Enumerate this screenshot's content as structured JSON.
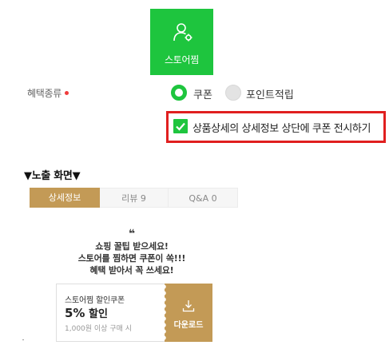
{
  "tile": {
    "label": "스토어찜",
    "icon": "user-gear-icon"
  },
  "benefit": {
    "label": "혜택종류",
    "options": [
      {
        "label": "쿠폰",
        "selected": true
      },
      {
        "label": "포인트적립",
        "selected": false
      }
    ]
  },
  "display_option": {
    "label": "상품상세의 상세정보 상단에 쿠폰 전시하기",
    "checked": true
  },
  "exposure": {
    "title": "▼노출 화면▼",
    "tabs": [
      {
        "label": "상세정보",
        "active": true
      },
      {
        "label": "리뷰  9",
        "active": false
      },
      {
        "label": "Q&A  0",
        "active": false
      }
    ]
  },
  "promo": {
    "quote": "❝",
    "lines": [
      "쇼핑 꿀팁 받으세요!",
      "스토어를 찜하면 쿠폰이 쏙!!!",
      "혜택 받아서 꼭 쓰세요!"
    ]
  },
  "coupon": {
    "name": "스토어찜 할인쿠폰",
    "discount_value": "5%",
    "discount_text": "할인",
    "condition": "1,000원 이상 구매 시",
    "download_label": "다운로드"
  },
  "colors": {
    "green": "#1ec53e",
    "gold": "#c39a56",
    "red": "#e01f1f"
  }
}
